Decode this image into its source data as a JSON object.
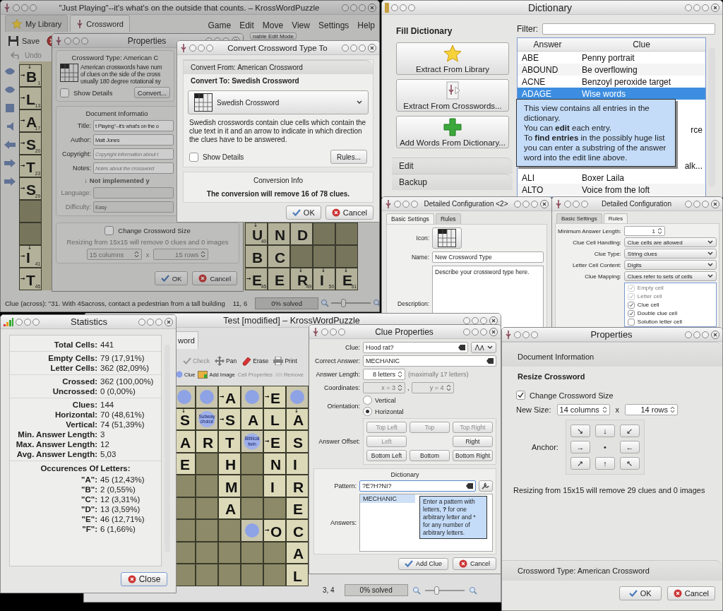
{
  "main_window": {
    "title": "\"Just Playing\"--it's what's on the outside that counts. – KrossWordPuzzle",
    "tabs": [
      {
        "kind": "library",
        "label": "My Library",
        "selected": false
      },
      {
        "kind": "crossword",
        "label": "Crossword",
        "selected": true
      }
    ],
    "menu": [
      "Game",
      "Edit",
      "Move",
      "View",
      "Settings",
      "Help"
    ],
    "toolbar": [
      {
        "label": "Save",
        "disabled": false
      },
      {
        "label": "nable Edit Mode"
      },
      {
        "label": "Undo",
        "disabled": true
      }
    ],
    "board_left": [
      {
        "kind": "letter",
        "letter": "B",
        "number": "1",
        "arrow_right": "→",
        "arrow_down": "↓"
      },
      {
        "kind": "letter",
        "letter": "L",
        "number": "13",
        "arrow_right": "→"
      },
      {
        "kind": "letter",
        "letter": "A",
        "number": "17",
        "arrow_right": "→"
      },
      {
        "kind": "letter",
        "letter": "S",
        "number": "20",
        "arrow_right": "→"
      },
      {
        "kind": "letter",
        "letter": "T",
        "number": "23",
        "arrow_right": "→"
      },
      {
        "kind": "letter",
        "letter": "S",
        "number": "29",
        "arrow_right": "→"
      },
      {
        "kind": "empty"
      },
      {
        "kind": "empty"
      },
      {
        "kind": "letter",
        "letter": "I",
        "number": "41",
        "arrow_right": "→",
        "arrow_down": "↓"
      },
      {
        "kind": "letter",
        "letter": "T",
        "number": "45",
        "arrow_right": "→"
      }
    ],
    "board_right": [
      [
        {
          "kind": "letter",
          "letter": "U",
          "number": "40",
          "arrow_down": "↓"
        },
        {
          "kind": "letter",
          "letter": "N"
        },
        {
          "kind": "letter",
          "letter": "D"
        },
        {
          "kind": "empty"
        },
        {
          "kind": "empty"
        }
      ],
      [
        {
          "kind": "letter",
          "letter": "B"
        },
        {
          "kind": "letter",
          "letter": "C"
        },
        {
          "kind": "empty"
        },
        {
          "kind": "empty"
        },
        {
          "kind": "empty"
        }
      ],
      [
        {
          "kind": "letter",
          "letter": "E",
          "number": "45",
          "arrow_right": "→"
        },
        {
          "kind": "letter",
          "letter": "E"
        },
        {
          "kind": "letter",
          "letter": "R",
          "number": "49",
          "arrow_down": "↓"
        },
        {
          "kind": "letter",
          "letter": "I",
          "number": "50",
          "arrow_down": "↓"
        },
        {
          "kind": "letter",
          "letter": "E",
          "number": "51",
          "arrow_down": "↓"
        }
      ]
    ],
    "status_bar": {
      "clue": "Clue (across): \"31. With 45across, contact a pedestrian from a tall building",
      "position": "11, 6",
      "progress": "0% solved",
      "level": 0,
      "zoom": {
        "level": 0.3
      }
    }
  },
  "properties_dialog": {
    "title": "Properties",
    "crossword_type": "Crossword Type: American C",
    "description": [
      "American crosswords have num",
      "of clues on the side of the cross",
      "usually 180 degree rotational sy"
    ],
    "show_details": {
      "label": "Show Details",
      "checked": false
    },
    "convert_button": "Convert...",
    "document_info": "Document Informatio",
    "fields": [
      {
        "label": "Title:",
        "value": "t Playing\"--it's what's on the o",
        "disabled": false
      },
      {
        "label": "Author:",
        "value": "Matt Jones",
        "disabled": false
      },
      {
        "label": "Copyright:",
        "placeholder": "Copyright information about t",
        "disabled": false
      },
      {
        "label": "Notes:",
        "placeholder": "Notes about the crossword",
        "disabled": false
      },
      {
        "label": "Language:",
        "disabled": true
      },
      {
        "label": "Difficulty:",
        "value": "Easy",
        "disabled": true
      }
    ],
    "not_implemented": "↓ Not implemented y",
    "change_size": {
      "label": "Change Crossword Size",
      "checked": false
    },
    "resize_info": "Resizing from 15x15 will remove 0 clues and 0 images",
    "columns": "15 columns",
    "times": "x",
    "rows": "15 rows",
    "buttons": [
      {
        "kind": "ok",
        "label": "OK"
      },
      {
        "kind": "cancel",
        "label": "Cancel"
      }
    ]
  },
  "convert_dialog": {
    "title": "Convert Crossword Type To",
    "sections": [
      {
        "label": "Convert From: American Crossword",
        "selected": false
      },
      {
        "label": "Convert To: Swedish Crossword",
        "selected": true
      }
    ],
    "type_combo": "Swedish Crossword",
    "description": "Swedish crosswords contain clue cells which contain the clue text in it and an arrow to indicate in which direction the clues have to be answered.",
    "show_details": {
      "label": "Show Details",
      "checked": false
    },
    "rules_button": "Rules...",
    "info_title": "Conversion Info",
    "info": "The conversion will remove 16 of 78 clues.",
    "buttons": [
      {
        "kind": "ok",
        "label": "OK"
      },
      {
        "kind": "cancel",
        "label": "Cancel"
      }
    ]
  },
  "dictionary_window": {
    "title": "Dictionary",
    "sections": [
      {
        "label": "Fill Dictionary",
        "selected": true
      },
      {
        "label": "Edit",
        "selected": false
      },
      {
        "label": "Backup",
        "selected": false
      }
    ],
    "actions": [
      {
        "kind": "star",
        "label": "Extract From Library"
      },
      {
        "kind": "crossword",
        "label": "Extract From Crosswords..."
      },
      {
        "kind": "plus",
        "label": "Add Words From Dictionary..."
      }
    ],
    "filter_label": "Filter:",
    "columns": [
      "Answer",
      "Clue"
    ],
    "rows": [
      {
        "answer": "ABE",
        "clue": "Penny portrait",
        "selected": false
      },
      {
        "answer": "ABOUND",
        "clue": "Be overflowing",
        "selected": false
      },
      {
        "answer": "ACNE",
        "clue": "Benzoyl peroxide target",
        "selected": false
      },
      {
        "answer": "ADAGE",
        "clue": "Wise words",
        "selected": true
      },
      {
        "clue_tail": "rce"
      },
      {
        "clue_tail": "alk..."
      },
      {
        "answer": "ALI",
        "clue": "Boxer Laila",
        "selected": false
      },
      {
        "answer": "ALTO",
        "clue": "Voice from the loft",
        "selected": false
      }
    ],
    "tooltip": "This view contains all entries in the dictionary.\nYou can **edit** each entry.\nTo **find entries** in the possibly huge list you can enter a substring of the answer word into the edit line above."
  },
  "config_window_2": {
    "title": "Detailed Configuration <2>",
    "tabs": [
      {
        "label": "Basic Settings",
        "selected": true
      },
      {
        "label": "Rules",
        "selected": false
      }
    ],
    "icon_label": "Icon:",
    "name_label": "Name:",
    "name": "New Crossword Type",
    "description_label": "Description:",
    "description": "Describe your crossword type here."
  },
  "config_window": {
    "title": "Detailed Configuration",
    "tabs": [
      {
        "label": "Basic Settings",
        "selected": false
      },
      {
        "label": "Rules",
        "selected": true
      }
    ],
    "settings": [
      {
        "kind": "spin",
        "label": "Minimum Answer Length:",
        "value": "1"
      },
      {
        "kind": "combo",
        "label": "Clue Cell Handling:",
        "value": "Clue cells are allowed"
      },
      {
        "kind": "combo",
        "label": "Clue Type:",
        "value": "String clues"
      },
      {
        "kind": "combo",
        "label": "Letter Cell Content:",
        "value": "Digits"
      },
      {
        "kind": "combo",
        "label": "Clue Mapping:",
        "value": "Clues refer to sets of cells"
      }
    ],
    "cell_types": [
      {
        "label": "Empty cell",
        "checked": true,
        "disabled": true
      },
      {
        "label": "Letter cell",
        "checked": true,
        "disabled": true
      },
      {
        "label": "Clue cell",
        "checked": true,
        "disabled": false
      },
      {
        "label": "Double clue cell",
        "checked": true,
        "disabled": false
      },
      {
        "label": "Solution letter cell",
        "checked": false,
        "disabled": false
      }
    ]
  },
  "test_window": {
    "title": "Test [modified] – KrossWordPuzzle",
    "tab": "word",
    "toolbar": [
      {
        "kind": "check",
        "label": "Check",
        "disabled": true
      },
      {
        "kind": "pan",
        "label": "Pan",
        "disabled": false
      },
      {
        "kind": "erase",
        "label": "Erase",
        "disabled": false
      },
      {
        "kind": "print",
        "label": "Print",
        "disabled": false
      }
    ],
    "toolbar2": [
      {
        "kind": "clue",
        "label": "Clue",
        "disabled": false
      },
      {
        "kind": "image",
        "label": "Add Image",
        "disabled": false
      },
      {
        "kind": "none",
        "label": "Cell Properties",
        "disabled": true
      },
      {
        "kind": "remove",
        "label": "Remove",
        "disabled": true
      }
    ],
    "board": [
      [
        {
          "kind": "clue"
        },
        {
          "kind": "clue"
        },
        {
          "kind": "letter",
          "letter": "A",
          "arrow_right": "→"
        },
        {
          "kind": "clue"
        },
        {
          "kind": "letter",
          "letter": "E",
          "arrow_right": "→"
        },
        {
          "kind": "clue"
        }
      ],
      [
        {
          "kind": "letter",
          "letter": "S",
          "arrow_down": "↓"
        },
        {
          "kind": "clue",
          "text": "Subway choice"
        },
        {
          "kind": "letter",
          "letter": "S",
          "arrow_right": "→"
        },
        {
          "kind": "letter",
          "letter": "A"
        },
        {
          "kind": "letter",
          "letter": "L"
        },
        {
          "kind": "letter",
          "letter": "A",
          "arrow_down": "↓"
        }
      ],
      [
        {
          "kind": "letter",
          "letter": "A"
        },
        {
          "kind": "letter",
          "letter": "R"
        },
        {
          "kind": "letter",
          "letter": "T"
        },
        {
          "kind": "clue",
          "text": "Biblical twin"
        },
        {
          "kind": "letter",
          "letter": "E",
          "arrow_right": "→"
        },
        {
          "kind": "letter",
          "letter": "S"
        }
      ],
      [
        {
          "kind": "letter",
          "letter": "E"
        },
        {
          "kind": "empty"
        },
        {
          "kind": "letter",
          "letter": "H"
        },
        {
          "kind": "empty"
        },
        {
          "kind": "letter",
          "letter": "N"
        },
        {
          "kind": "letter",
          "letter": "I"
        }
      ],
      [
        {
          "kind": "empty"
        },
        {
          "kind": "empty"
        },
        {
          "kind": "letter",
          "letter": "M"
        },
        {
          "kind": "empty"
        },
        {
          "kind": "letter",
          "letter": "I"
        },
        {
          "kind": "letter",
          "letter": "R"
        }
      ],
      [
        {
          "kind": "empty"
        },
        {
          "kind": "empty"
        },
        {
          "kind": "letter",
          "letter": "A"
        },
        {
          "kind": "empty"
        },
        {
          "kind": "empty"
        },
        {
          "kind": "letter",
          "letter": "E"
        }
      ],
      [
        {
          "kind": "empty"
        },
        {
          "kind": "empty"
        },
        {
          "kind": "empty"
        },
        {
          "kind": "clue"
        },
        {
          "kind": "letter",
          "letter": "O",
          "arrow_right": "→"
        },
        {
          "kind": "letter",
          "letter": "C"
        }
      ],
      [
        {
          "kind": "empty"
        },
        {
          "kind": "empty"
        },
        {
          "kind": "empty"
        },
        {
          "kind": "empty"
        },
        {
          "kind": "empty"
        },
        {
          "kind": "letter",
          "letter": "A"
        }
      ],
      [
        {
          "kind": "empty"
        },
        {
          "kind": "empty"
        },
        {
          "kind": "empty"
        },
        {
          "kind": "empty"
        },
        {
          "kind": "empty"
        },
        {
          "kind": "letter",
          "letter": "L"
        }
      ]
    ],
    "status_bar": {
      "position": "3, 4",
      "progress": "0% solved",
      "level": 0,
      "zoom": {
        "level": 0.3
      }
    }
  },
  "statistics_window": {
    "title": "Statistics",
    "groups": [
      [
        {
          "label": "Total Cells:",
          "value": "441"
        }
      ],
      [
        {
          "label": "Empty Cells:",
          "value": "79 (17,91%)"
        },
        {
          "label": "Letter Cells:",
          "value": "362 (82,09%)"
        }
      ],
      [
        {
          "label": "Crossed:",
          "value": "362 (100,00%)"
        },
        {
          "label": "Uncrossed:",
          "value": "0 (0,00%)"
        }
      ],
      [
        {
          "label": "Clues:",
          "value": "144"
        },
        {
          "label": "Horizontal:",
          "value": "70 (48,61%)"
        },
        {
          "label": "Vertical:",
          "value": "74 (51,39%)"
        },
        {
          "label": "Min. Answer Length:",
          "value": "3"
        },
        {
          "label": "Max. Answer Length:",
          "value": "12"
        },
        {
          "label": "Avg. Answer Length:",
          "value": "5,03"
        }
      ]
    ],
    "letters_heading": "Occurences Of Letters:",
    "letters": [
      {
        "label": "\"A\":",
        "value": "45 (12,43%)"
      },
      {
        "label": "\"B\":",
        "value": "2 (0,55%)"
      },
      {
        "label": "\"C\":",
        "value": "12 (3,31%)"
      },
      {
        "label": "\"D\":",
        "value": "13 (3,59%)"
      },
      {
        "label": "\"E\":",
        "value": "46 (12,71%)"
      },
      {
        "label": "\"F\":",
        "value": "6 (1,66%)"
      }
    ],
    "close": "Close"
  },
  "clue_dialog": {
    "title": "Clue Properties",
    "clue_label": "Clue:",
    "clue": "Hood rat?",
    "answer_label": "Correct Answer:",
    "answer": "MECHANIC",
    "length_label": "Answer Length:",
    "length": "8 letters",
    "length_hint": "(maximally 17 letters)",
    "coords_label": "Coordinates:",
    "x": "x = 3",
    "separator": ",",
    "y": "y = 4",
    "orientation_label": "Orientation:",
    "orientations": [
      {
        "label": "Vertical",
        "selected": false
      },
      {
        "label": "Horizontal",
        "selected": true
      }
    ],
    "offset_label": "Answer Offset:",
    "offsets": [
      {
        "label": "Top Left",
        "disabled": true
      },
      {
        "label": "Top",
        "disabled": true
      },
      {
        "label": "Top Right",
        "disabled": true
      },
      {
        "label": "Left",
        "disabled": true
      },
      {
        "label": "Right",
        "disabled": false
      },
      {
        "label": "Bottom Left",
        "disabled": false
      },
      {
        "label": "Bottom",
        "disabled": false
      },
      {
        "label": "Bottom Right",
        "disabled": false
      }
    ],
    "dictionary_title": "Dictionary",
    "pattern_label": "Pattern:",
    "pattern": "?E?H?NI?",
    "answers_label": "Answers:",
    "answers": [
      {
        "label": "MECHANIC",
        "selected": true
      }
    ],
    "tooltip": "Enter a pattern with letters, **?** for one arbitrary letter and * for any number of arbitrary letters.",
    "buttons": [
      {
        "kind": "ok",
        "label": "Add Clue"
      },
      {
        "kind": "cancel",
        "label": "Cancel"
      }
    ]
  },
  "resize_dialog": {
    "title": "Properties",
    "sections": [
      {
        "label": "Document Information",
        "selected": false
      },
      {
        "label": "Resize Crossword",
        "selected": true
      },
      {
        "label": "Crossword Type: American Crossword",
        "selected": false
      }
    ],
    "change_size": {
      "label": "Change Crossword Size",
      "checked": true
    },
    "size_label": "New Size:",
    "columns": "14 columns",
    "times": "x",
    "rows": "14 rows",
    "anchor_label": "Anchor:",
    "anchors": [
      {
        "label": "↘",
        "selected": false
      },
      {
        "label": "↓",
        "selected": false
      },
      {
        "label": "↙",
        "selected": false
      },
      {
        "label": "→",
        "selected": false
      },
      {
        "label": "•",
        "selected": true
      },
      {
        "label": "←",
        "selected": false
      },
      {
        "label": "↗",
        "selected": false
      },
      {
        "label": "↑",
        "selected": false
      },
      {
        "label": "↖",
        "selected": false
      }
    ],
    "resize_info": "Resizing from 15x15 will remove 29 clues and 0 images",
    "buttons": [
      {
        "kind": "ok",
        "label": "OK"
      },
      {
        "kind": "cancel",
        "label": "Cancel"
      }
    ]
  }
}
